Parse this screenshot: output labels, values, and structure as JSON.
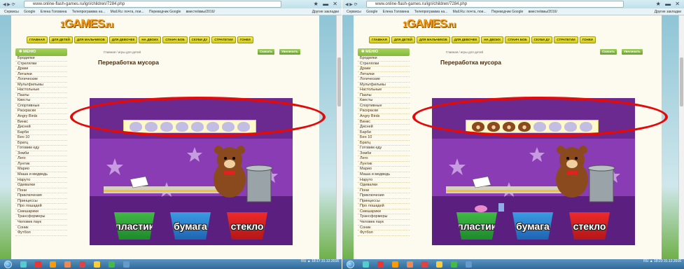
{
  "browser": {
    "url": "www.online-flash-games.ru/igri/children/7284.php",
    "nav_buttons": "◀ ▶ ⟳",
    "window_controls": "★ ▬ ✕",
    "bookmarks": [
      "Сервисы",
      "Google",
      "Елена Головина",
      "Телепрограмма на...",
      "Mail.Ru: почта, пои...",
      "Переводчик Google",
      "вместе/вмы/2016/"
    ],
    "bookmarks_other": "Другие закладки"
  },
  "site": {
    "logo_prefix": "1",
    "logo_main": "GAMES",
    "logo_suffix": ".ru",
    "nav": [
      "ГЛАВНАЯ",
      "ДЛЯ ДЕТЕЙ",
      "ДЛЯ МАЛЬЧИКОВ",
      "ДЛЯ ДЕВОЧЕК",
      "НА ДВОИХ",
      "СПАНЧ БОБ",
      "СКУБИ ДУ",
      "СТРАТЕГИИ",
      "ГОНКИ"
    ],
    "menu_title": "МЕНЮ",
    "menu_items": [
      "Бродилки",
      "Стрелялки",
      "Драки",
      "Леталки",
      "Логические",
      "Мультфильмы",
      "Настольные",
      "Пазлы",
      "Квесты",
      "Спортивные",
      "Раскраски",
      "Angry Birds",
      "Винкс",
      "Дисней",
      "Барби",
      "Бен 10",
      "Братц",
      "Готовим еду",
      "Зомби",
      "Лего",
      "Лунтик",
      "Марио",
      "Маша и медведь",
      "Наруто",
      "Одевалки",
      "Пони",
      "Приключения",
      "Принцессы",
      "Про лошадей",
      "Смешарики",
      "Трансформеры",
      "Человек паук",
      "Соник",
      "Футбол"
    ],
    "breadcrumb": "Главная / игры для детей",
    "download_button": "Скачать",
    "fullscreen_button": "Увеличить",
    "page_title": "Переработка мусора"
  },
  "game": {
    "bin_labels": [
      "пластик",
      "бумага",
      "стекло"
    ],
    "slots_total": 8,
    "left_filled": 0,
    "right_filled": 4,
    "colors": {
      "plastic": "#2a9e3a",
      "paper": "#2a7fd0",
      "glass": "#d82020",
      "highlight": "#e30a0a",
      "purple": "#8a3cb4"
    }
  },
  "taskbar": {
    "left_tray": "RU ▲ 18:17 31.12.2016",
    "right_tray": "RU ▲ 18:23 31.12.2016"
  }
}
